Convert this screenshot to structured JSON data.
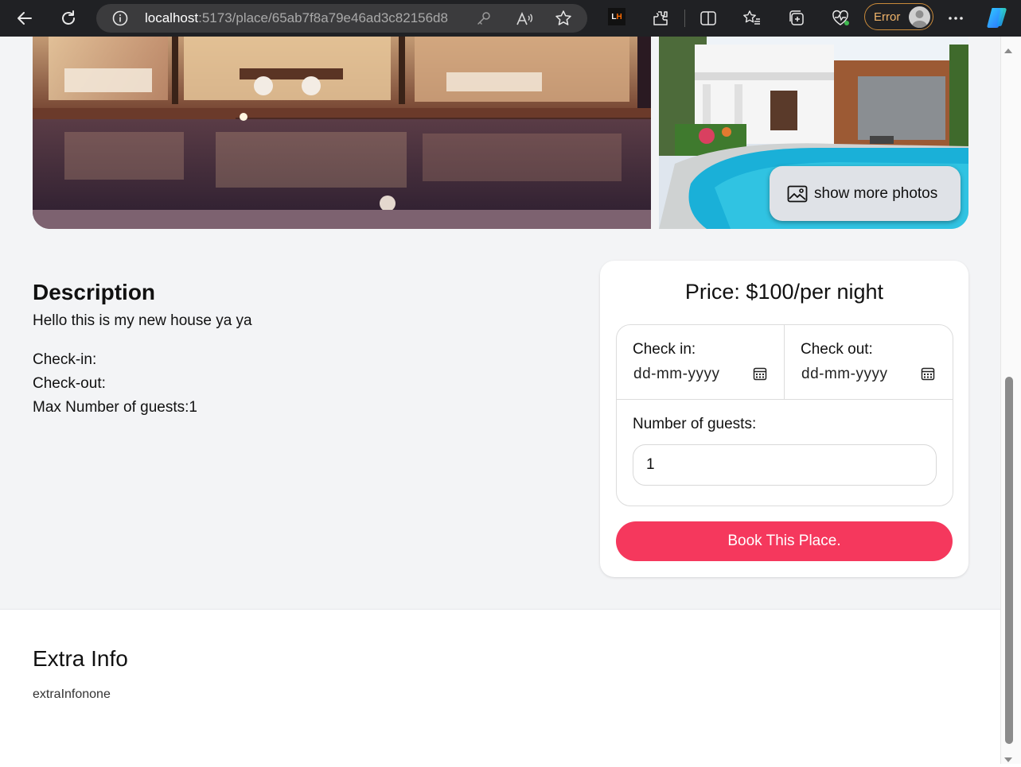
{
  "browser": {
    "url_host": "localhost",
    "url_path": ":5173/place/65ab7f8a79e46ad3c82156d8",
    "ext_badge": {
      "l": "L",
      "h": "H"
    },
    "profile_label": "Error"
  },
  "gallery": {
    "show_more_label": "show more photos"
  },
  "description": {
    "heading": "Description",
    "text": "Hello this is my new house ya ya",
    "check_in": "Check-in:",
    "check_out": "Check-out:",
    "max_guests": "Max Number of guests:1"
  },
  "booking": {
    "price": "Price: $100/per night",
    "check_in_label": "Check in:",
    "check_in_placeholder": "dd-mm-yyyy",
    "check_out_label": "Check out:",
    "check_out_placeholder": "dd-mm-yyyy",
    "guests_label": "Number of guests:",
    "guests_value": "1",
    "book_label": "Book This Place.",
    "accent_color": "#f5385d"
  },
  "extra": {
    "heading": "Extra Info",
    "text": "extraInfonone"
  }
}
